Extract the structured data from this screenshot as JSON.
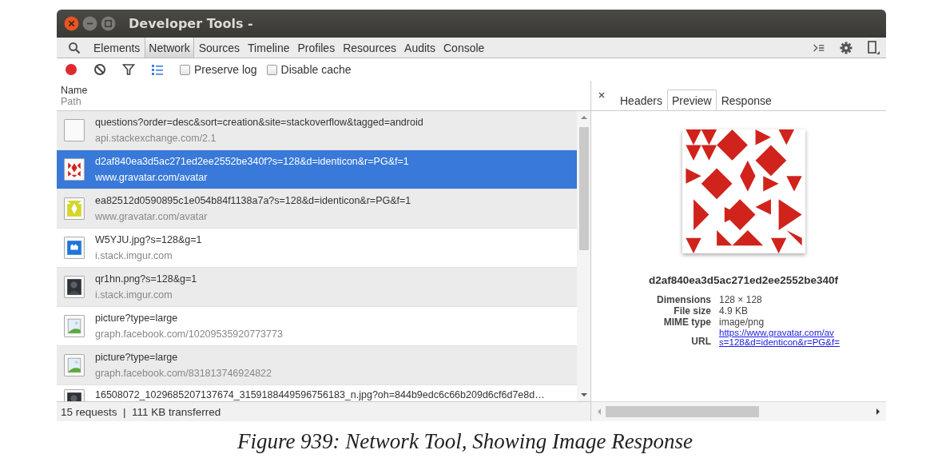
{
  "window": {
    "title": "Developer Tools -"
  },
  "tabs": [
    {
      "label": "Elements",
      "selected": false
    },
    {
      "label": "Network",
      "selected": true
    },
    {
      "label": "Sources",
      "selected": false
    },
    {
      "label": "Timeline",
      "selected": false
    },
    {
      "label": "Profiles",
      "selected": false
    },
    {
      "label": "Resources",
      "selected": false
    },
    {
      "label": "Audits",
      "selected": false
    },
    {
      "label": "Console",
      "selected": false
    }
  ],
  "toolbar": {
    "checkboxes": [
      {
        "label": "Preserve log",
        "checked": false
      },
      {
        "label": "Disable cache",
        "checked": false
      }
    ]
  },
  "list_header": {
    "name": "Name",
    "path": "Path"
  },
  "requests": [
    {
      "kind": "blank",
      "name": "questions?order=desc&sort=creation&site=stackoverflow&tagged=android",
      "path": "api.stackexchange.com/2.1",
      "selected": false
    },
    {
      "kind": "identicon-red",
      "name": "d2af840ea3d5ac271ed2ee2552be340f?s=128&d=identicon&r=PG&f=1",
      "path": "www.gravatar.com/avatar",
      "selected": true
    },
    {
      "kind": "identicon-yellow",
      "name": "ea82512d0590895c1e054b84f1138a7a?s=128&d=identicon&r=PG&f=1",
      "path": "www.gravatar.com/avatar",
      "selected": false
    },
    {
      "kind": "logo",
      "name": "W5YJU.jpg?s=128&g=1",
      "path": "i.stack.imgur.com",
      "selected": false
    },
    {
      "kind": "photo",
      "name": "qr1hn.png?s=128&g=1",
      "path": "i.stack.imgur.com",
      "selected": false
    },
    {
      "kind": "broken",
      "name": "picture?type=large",
      "path": "graph.facebook.com/10209535920773773",
      "selected": false
    },
    {
      "kind": "broken",
      "name": "picture?type=large",
      "path": "graph.facebook.com/831813746924822",
      "selected": false
    },
    {
      "kind": "photo",
      "name": "16508072_1029685207137674_3159188449596756183_n.jpg?oh=844b9edc6c66b209d6cf6d7e8d…"
    }
  ],
  "status_bar": "15 requests  |  111 KB transferred",
  "detail_tabs": [
    {
      "label": "Headers",
      "selected": false
    },
    {
      "label": "Preview",
      "selected": true
    },
    {
      "label": "Response",
      "selected": false
    }
  ],
  "preview": {
    "filename": "d2af840ea3d5ac271ed2ee2552be340f",
    "fields": [
      {
        "label": "Dimensions",
        "value": "128 × 128"
      },
      {
        "label": "File size",
        "value": "4.9 KB"
      },
      {
        "label": "MIME type",
        "value": "image/png"
      },
      {
        "label": "URL",
        "lines": [
          "https://www.gravatar.com/av",
          "s=128&d=identicon&r=PG&f="
        ]
      }
    ]
  },
  "caption": "Figure 939: Network Tool, Showing Image Response"
}
